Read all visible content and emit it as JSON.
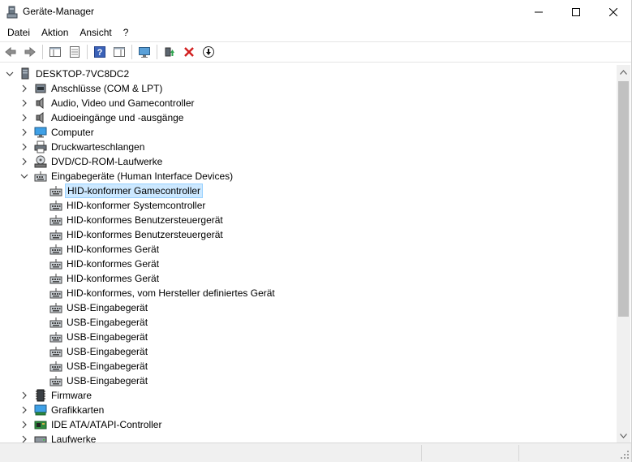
{
  "window": {
    "title": "Geräte-Manager",
    "minimize_glyph": "—",
    "maximize_glyph": "☐",
    "close_glyph": "✕"
  },
  "menu": [
    "Datei",
    "Aktion",
    "Ansicht",
    "?"
  ],
  "toolbar": {
    "buttons": [
      "back-icon",
      "forward-icon",
      "show-hide-console-tree-icon",
      "properties-icon",
      "help-icon",
      "action-pane-icon",
      "monitor-scan-icon",
      "update-driver-icon",
      "uninstall-device-icon",
      "download-icon"
    ]
  },
  "tree": {
    "root": "DESKTOP-7VC8DC2",
    "categories": [
      {
        "label": "Anschlüsse (COM & LPT)",
        "icon": "port-icon",
        "expanded": false
      },
      {
        "label": "Audio, Video und Gamecontroller",
        "icon": "speaker-icon",
        "expanded": false
      },
      {
        "label": "Audioeingänge und -ausgänge",
        "icon": "speaker-icon",
        "expanded": false
      },
      {
        "label": "Computer",
        "icon": "computer-icon",
        "expanded": false
      },
      {
        "label": "Druckwarteschlangen",
        "icon": "printer-icon",
        "expanded": false
      },
      {
        "label": "DVD/CD-ROM-Laufwerke",
        "icon": "disc-drive-icon",
        "expanded": false
      },
      {
        "label": "Eingabegeräte (Human Interface Devices)",
        "icon": "hid-icon",
        "expanded": true
      },
      {
        "label": "Firmware",
        "icon": "firmware-icon",
        "expanded": false
      },
      {
        "label": "Grafikkarten",
        "icon": "display-adapter-icon",
        "expanded": false
      },
      {
        "label": "IDE ATA/ATAPI-Controller",
        "icon": "ide-controller-icon",
        "expanded": false
      },
      {
        "label": "Laufwerke",
        "icon": "disk-drive-icon",
        "expanded": false
      }
    ],
    "hid_children": [
      "HID-konformer Gamecontroller",
      "HID-konformer Systemcontroller",
      "HID-konformes Benutzersteuergerät",
      "HID-konformes Benutzersteuergerät",
      "HID-konformes Gerät",
      "HID-konformes Gerät",
      "HID-konformes Gerät",
      "HID-konformes, vom Hersteller definiertes Gerät",
      "USB-Eingabegerät",
      "USB-Eingabegerät",
      "USB-Eingabegerät",
      "USB-Eingabegerät",
      "USB-Eingabegerät",
      "USB-Eingabegerät"
    ],
    "selected": "HID-konformer Gamecontroller"
  },
  "colors": {
    "selection_bg": "#cce8ff",
    "selection_border": "#99d1ff"
  }
}
